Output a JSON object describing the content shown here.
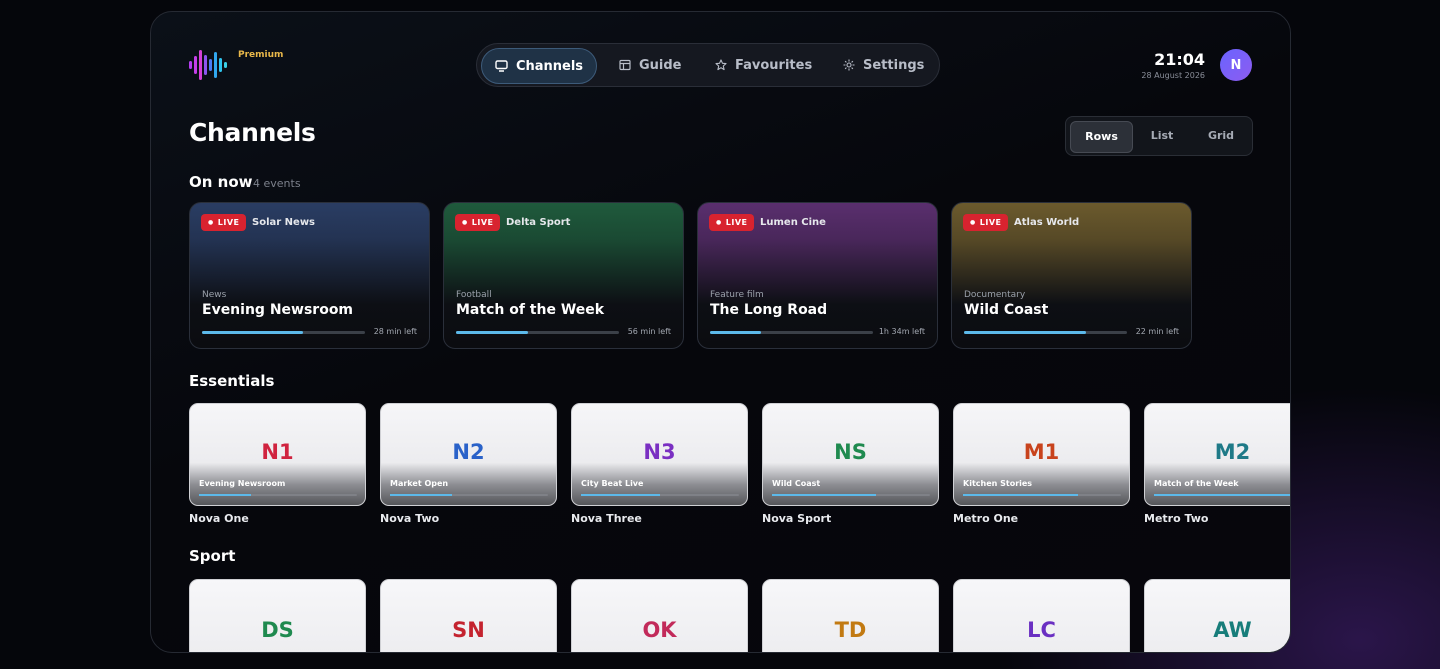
{
  "header": {
    "badge": "Premium",
    "time": "21:04",
    "date": "28 August 2026",
    "avatar_initial": "N"
  },
  "nav": {
    "items": [
      {
        "label": "Channels",
        "icon": "tv-icon",
        "active": true
      },
      {
        "label": "Guide",
        "icon": "guide-grid-icon",
        "active": false
      },
      {
        "label": "Favourites",
        "icon": "star-icon",
        "active": false
      },
      {
        "label": "Settings",
        "icon": "gear-icon",
        "active": false
      }
    ]
  },
  "page": {
    "title": "Channels",
    "view_modes": [
      "Rows",
      "List",
      "Grid"
    ],
    "active_view": "Rows"
  },
  "on_now": {
    "title": "On now",
    "count_label": "4 events",
    "live_label": "LIVE",
    "cards": [
      {
        "channel": "Solar News",
        "genre": "News",
        "title": "Evening Newsroom",
        "remaining": "28 min left",
        "progress": 0.62,
        "color": "#2a3d63"
      },
      {
        "channel": "Delta Sport",
        "genre": "Football",
        "title": "Match of the Week",
        "remaining": "56 min left",
        "progress": 0.44,
        "color": "#1f5a3c"
      },
      {
        "channel": "Lumen Cine",
        "genre": "Feature film",
        "title": "The Long Road",
        "remaining": "1h 34m left",
        "progress": 0.31,
        "color": "#5a2f6e"
      },
      {
        "channel": "Atlas World",
        "genre": "Documentary",
        "title": "Wild Coast",
        "remaining": "22 min left",
        "progress": 0.75,
        "color": "#6b5a2d"
      }
    ]
  },
  "essentials": {
    "title": "Essentials",
    "channels": [
      {
        "code": "N1",
        "name": "Nova One",
        "program": "Evening Newsroom",
        "progress": 0.33,
        "color": "#d0233f"
      },
      {
        "code": "N2",
        "name": "Nova Two",
        "program": "Market Open",
        "progress": 0.39,
        "color": "#2a62c9"
      },
      {
        "code": "N3",
        "name": "Nova Three",
        "program": "City Beat Live",
        "progress": 0.5,
        "color": "#7a2fc2"
      },
      {
        "code": "NS",
        "name": "Nova Sport",
        "program": "Wild Coast",
        "progress": 0.66,
        "color": "#1f8a4f"
      },
      {
        "code": "M1",
        "name": "Metro One",
        "program": "Kitchen Stories",
        "progress": 0.73,
        "color": "#c8431d"
      },
      {
        "code": "M2",
        "name": "Metro Two",
        "program": "Match of the Week",
        "progress": 0.9,
        "color": "#1f7a88"
      }
    ]
  },
  "sport": {
    "title": "Sport",
    "channels": [
      {
        "code": "DS",
        "color": "#1f8a4f"
      },
      {
        "code": "SN",
        "color": "#c4232f"
      },
      {
        "code": "OK",
        "color": "#c22a5a"
      },
      {
        "code": "TD",
        "color": "#c27a12"
      },
      {
        "code": "LC",
        "color": "#6a2fc2"
      },
      {
        "code": "AW",
        "color": "#177d7a"
      }
    ]
  },
  "colors": {
    "accent": "#5cb9ea",
    "live": "#d8232f",
    "premium": "#e9b84a"
  }
}
